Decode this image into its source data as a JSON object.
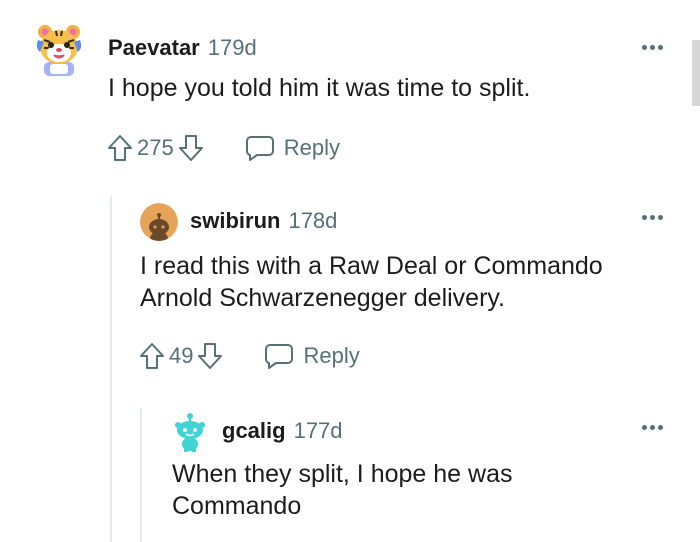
{
  "comments": [
    {
      "author": "Paevatar",
      "age": "179d",
      "lines": [
        "I hope you told him it was time to split."
      ],
      "score": "275",
      "reply_label": "Reply",
      "avatar": "tiger-avatar-icon"
    },
    {
      "author": "swibirun",
      "age": "178d",
      "lines": [
        "I read this with a Raw Deal or Commando",
        "Arnold Schwarzenegger delivery."
      ],
      "score": "49",
      "reply_label": "Reply",
      "avatar": "snoo-orange-avatar-icon"
    },
    {
      "author": "gcalig",
      "age": "177d",
      "lines": [
        "When they split, I hope he was",
        "Commando"
      ],
      "avatar": "snoo-teal-avatar-icon"
    }
  ],
  "colors": {
    "text": "#1c1c1c",
    "meta": "#576f76",
    "thread_line": "#e5ebee",
    "avatar_orange": "#e6a35a",
    "avatar_teal": "#3fd5d5"
  }
}
